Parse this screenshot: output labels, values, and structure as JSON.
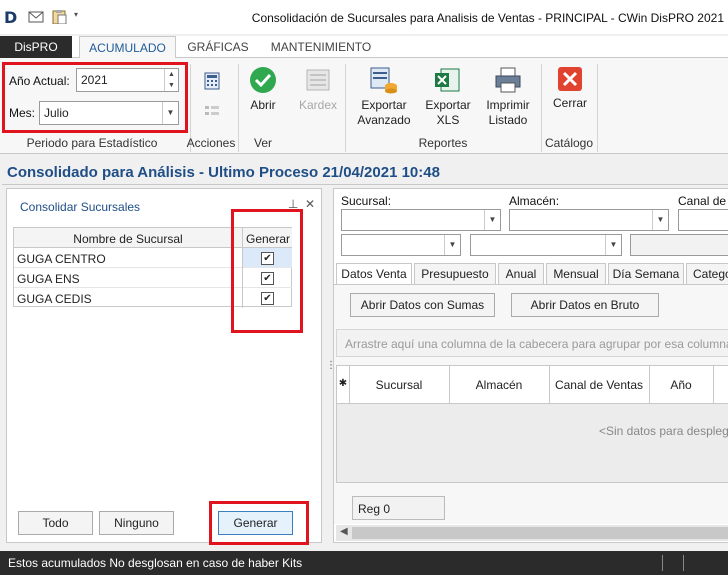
{
  "window": {
    "title": "Consolidación de Sucursales para Analisis de Ventas - PRINCIPAL - CWin DisPRO 2021",
    "logo_letter": "D"
  },
  "tabs": [
    "DisPRO",
    "ACUMULADO",
    "GRÁFICAS",
    "MANTENIMIENTO"
  ],
  "ribbon": {
    "periodo": {
      "anio_label": "Año Actual:",
      "anio_value": "2021",
      "mes_label": "Mes:",
      "mes_value": "Julio",
      "group_label": "Periodo para Estadístico"
    },
    "acciones_label": "Acciones",
    "ver": {
      "abrir": "Abrir",
      "kardex": "Kardex",
      "group_label": "Ver"
    },
    "reportes": {
      "exportar_avanzado_1": "Exportar",
      "exportar_avanzado_2": "Avanzado",
      "exportar_xls_1": "Exportar",
      "exportar_xls_2": "XLS",
      "imprimir_1": "Imprimir",
      "imprimir_2": "Listado",
      "group_label": "Reportes"
    },
    "catalogo": {
      "cerrar": "Cerrar",
      "group_label": "Catálogo"
    }
  },
  "header": {
    "title": "Consolidado para Análisis - Ultimo Proceso 21/04/2021 10:48"
  },
  "left_panel": {
    "title": "Consolidar Sucursales",
    "columns": [
      "Nombre de Sucursal",
      "Generar"
    ],
    "rows": [
      {
        "name": "GUGA CENTRO",
        "checked": true
      },
      {
        "name": "GUGA ENS",
        "checked": true
      },
      {
        "name": "GUGA CEDIS",
        "checked": true
      }
    ],
    "buttons": {
      "todo": "Todo",
      "ninguno": "Ninguno",
      "generar": "Generar"
    }
  },
  "right_panel": {
    "filters": {
      "sucursal": "Sucursal:",
      "almacen": "Almacén:",
      "canal": "Canal de V"
    },
    "tabs": [
      "Datos Venta",
      "Presupuesto",
      "Anual",
      "Mensual",
      "Día Semana",
      "Catego"
    ],
    "buttons": {
      "sumas": "Abrir Datos con Sumas",
      "bruto": "Abrir Datos en Bruto"
    },
    "group_hint": "Arrastre aquí una columna de la cabecera para agrupar por esa columna",
    "columns": [
      "Sucursal",
      "Almacén",
      "Canal de Ventas",
      "Año"
    ],
    "no_data": "<Sin datos para desplega",
    "reg": "Reg 0"
  },
  "status": {
    "text": "Estos acumulados No desglosan en caso de haber Kits"
  },
  "colors": {
    "accent": "#1f4e87",
    "highlight": "#e0141e",
    "status_bg": "#2b2b2b"
  }
}
